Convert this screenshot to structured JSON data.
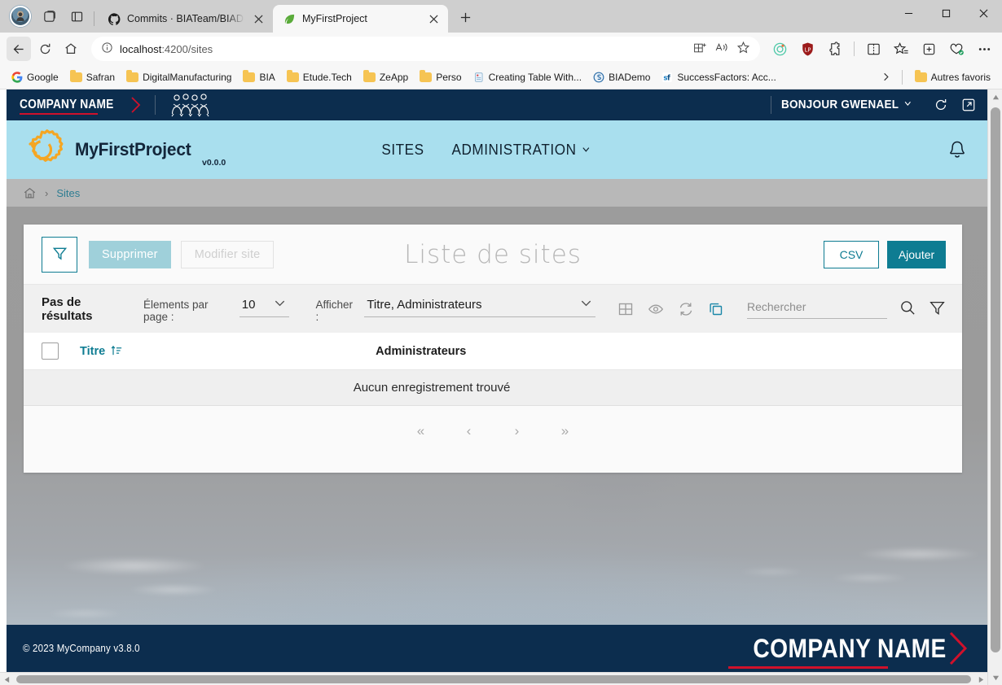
{
  "browser": {
    "tabs": [
      {
        "title": "Commits · BIATeam/BIADemo · G",
        "favicon": "github-icon",
        "active": false
      },
      {
        "title": "MyFirstProject",
        "favicon": "leaf-icon",
        "active": true
      }
    ],
    "new_tab_label": "+",
    "window_controls": {
      "minimize": "—",
      "maximize": "□",
      "close": "✕"
    },
    "address": {
      "host": "localhost",
      "path": ":4200/sites",
      "full": "localhost:4200/sites"
    },
    "nav": {
      "back": "back-arrow",
      "reload": "reload",
      "home": "home"
    },
    "bookmarks": [
      {
        "label": "Google",
        "icon": "google-icon"
      },
      {
        "label": "Safran",
        "icon": "folder-icon"
      },
      {
        "label": "DigitalManufacturing",
        "icon": "folder-icon"
      },
      {
        "label": "BIA",
        "icon": "folder-icon"
      },
      {
        "label": "Etude.Tech",
        "icon": "folder-icon"
      },
      {
        "label": "ZeApp",
        "icon": "folder-icon"
      },
      {
        "label": "Perso",
        "icon": "folder-icon"
      },
      {
        "label": "Creating Table With...",
        "icon": "page-icon"
      },
      {
        "label": "BIADemo",
        "icon": "swirl-icon"
      },
      {
        "label": "SuccessFactors: Acc...",
        "icon": "sf-icon"
      }
    ],
    "bookmarks_overflow": "›",
    "other_favorites": {
      "label": "Autres favoris",
      "icon": "folder-icon"
    }
  },
  "topbar": {
    "company_name": "COMPANY NAME",
    "people_icon": "people-group-icon",
    "greeting": "BONJOUR GWENAEL",
    "refresh_icon": "refresh-icon",
    "fullscreen_icon": "open-in-new-icon"
  },
  "appbar": {
    "logo_icon": "gear-icon",
    "app_name": "MyFirstProject",
    "version": "v0.0.0",
    "menu": [
      {
        "label": "SITES",
        "has_dropdown": false
      },
      {
        "label": "ADMINISTRATION",
        "has_dropdown": true
      }
    ],
    "bell_icon": "bell-icon"
  },
  "breadcrumb": {
    "home_icon": "home-icon",
    "separator": "›",
    "current": "Sites"
  },
  "card": {
    "title": "Liste de sites",
    "filter_button": "filter-funnel-icon",
    "delete_label": "Supprimer",
    "edit_label": "Modifier site",
    "csv_label": "CSV",
    "add_label": "Ajouter"
  },
  "toolbar": {
    "no_results": "Pas de résultats",
    "per_page_label": "Élements par page :",
    "per_page_value": "10",
    "display_label": "Afficher :",
    "display_value": "Titre, Administrateurs",
    "icons": [
      {
        "name": "grid-columns-icon",
        "teal": false
      },
      {
        "name": "eye-icon",
        "teal": false
      },
      {
        "name": "refresh-icon",
        "teal": false
      },
      {
        "name": "duplicate-icon",
        "teal": true
      }
    ],
    "search_placeholder": "Rechercher",
    "search_value": "",
    "search_icon": "search-icon",
    "advanced_filter_icon": "filter-funnel-icon"
  },
  "table": {
    "select_all": "",
    "columns": [
      {
        "label": "Titre",
        "sortable": true,
        "sort_icon": "sort-asc-icon"
      },
      {
        "label": "Administrateurs",
        "sortable": false
      }
    ],
    "rows": [],
    "empty_message": "Aucun enregistrement trouvé"
  },
  "pagination": {
    "first": "«",
    "prev": "‹",
    "next": "›",
    "last": "»"
  },
  "footer": {
    "copyright": "© 2023 MyCompany v3.8.0",
    "company_name": "COMPANY NAME"
  },
  "colors": {
    "navy": "#0c2d4e",
    "light_blue": "#a9dfee",
    "teal": "#0e7c92",
    "teal_soft": "#9fd0da",
    "red_accent": "#d0112b",
    "gear_orange": "#f5a623",
    "card_bg": "#fafafa",
    "toolbar_bg": "#f0f0f0"
  }
}
